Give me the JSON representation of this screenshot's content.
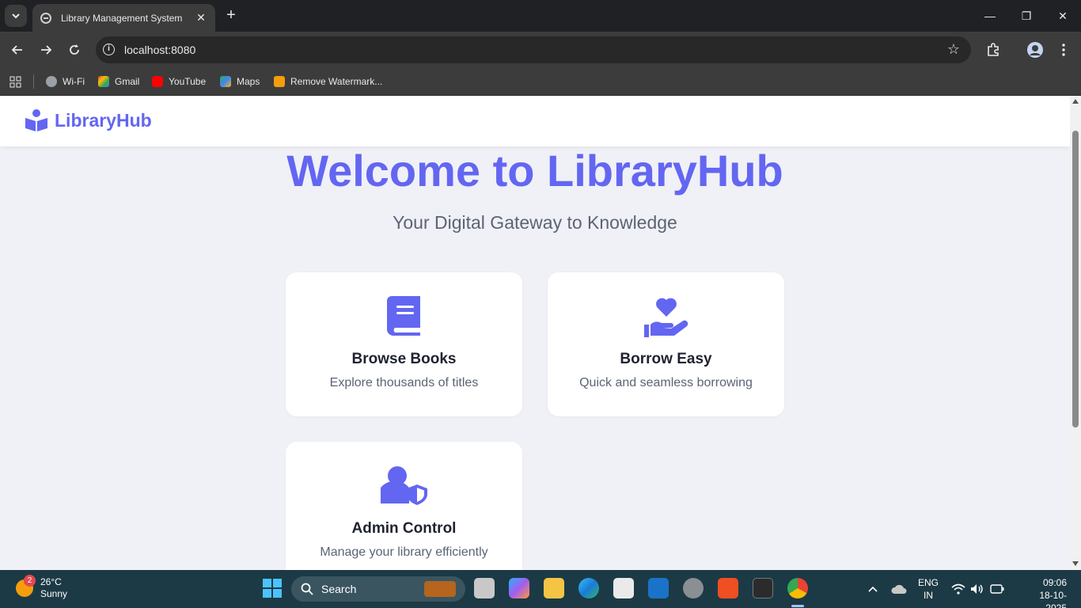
{
  "browser": {
    "tab_title": "Library Management System",
    "tab_close": "✕",
    "new_tab": "+",
    "url": "localhost:8080",
    "window_controls": {
      "minimize": "—",
      "restore": "❐",
      "close": "✕"
    }
  },
  "bookmarks": [
    {
      "label": "Wi-Fi",
      "icon": "globe-icon"
    },
    {
      "label": "Gmail",
      "icon": "gmail-icon"
    },
    {
      "label": "YouTube",
      "icon": "youtube-icon"
    },
    {
      "label": "Maps",
      "icon": "maps-icon"
    },
    {
      "label": "Remove Watermark...",
      "icon": "watermark-icon"
    }
  ],
  "site": {
    "brand": "LibraryHub",
    "hero_title": "Welcome to LibraryHub",
    "hero_subtitle": "Your Digital Gateway to Knowledge",
    "cards": [
      {
        "title": "Browse Books",
        "description": "Explore thousands of titles",
        "icon": "book-icon"
      },
      {
        "title": "Borrow Easy",
        "description": "Quick and seamless borrowing",
        "icon": "hand-heart-icon"
      },
      {
        "title": "Admin Control",
        "description": "Manage your library efficiently",
        "icon": "user-shield-icon"
      }
    ],
    "accent_color": "#6366f1"
  },
  "taskbar": {
    "weather_badge": "2",
    "temperature": "26°C",
    "condition": "Sunny",
    "search_placeholder": "Search",
    "language": "ENG",
    "region": "IN",
    "time": "09:06",
    "date": "18-10-2025"
  }
}
